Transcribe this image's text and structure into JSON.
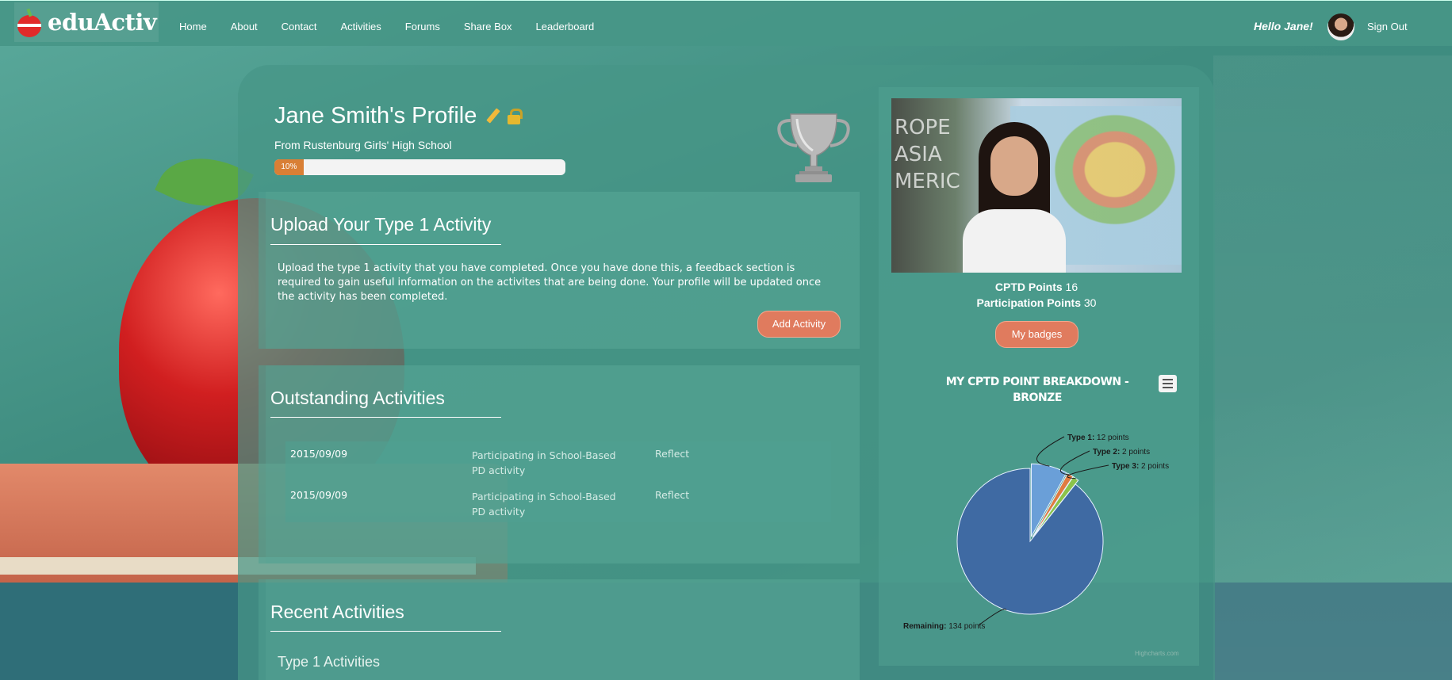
{
  "nav": {
    "brand": "eduActiv",
    "items": [
      "Home",
      "About",
      "Contact",
      "Activities",
      "Forums",
      "Share Box",
      "Leaderboard"
    ],
    "greeting": "Hello Jane!",
    "sign_out": "Sign Out"
  },
  "profile": {
    "title": "Jane Smith's Profile",
    "school": "From Rustenburg Girls' High School",
    "progress_label": "10%",
    "progress_value": 0.1
  },
  "upload": {
    "title": "Upload Your Type 1 Activity",
    "text": "Upload the type 1 activity that you have completed. Once you have done this, a feedback section is required to gain useful information on the activites that are being done. Your profile will be updated once the activity has been completed.",
    "button": "Add Activity"
  },
  "outstanding": {
    "title": "Outstanding Activities",
    "rows": [
      {
        "date": "2015/09/09",
        "activity": "Participating in School-Based PD activity",
        "action": "Reflect"
      },
      {
        "date": "2015/09/09",
        "activity": "Participating in School-Based PD activity",
        "action": "Reflect"
      }
    ]
  },
  "recent": {
    "title": "Recent Activities",
    "subheading": "Type 1 Activities"
  },
  "stats": {
    "cptd_label": "CPTD Points",
    "cptd_value": "16",
    "participation_label": "Participation Points",
    "participation_value": "30",
    "badges_button": "My badges"
  },
  "chart_data": {
    "type": "pie",
    "title": "MY CPTD POINT BREAKDOWN - BRONZE",
    "credit": "Highcharts.com",
    "slices": [
      {
        "name": "Type 1",
        "label": "12 points",
        "value": 12,
        "color": "#6a9fd8"
      },
      {
        "name": "Type 2",
        "label": "2 points",
        "value": 2,
        "color": "#e07b40"
      },
      {
        "name": "Type 3",
        "label": "2 points",
        "value": 2,
        "color": "#8bc34a"
      },
      {
        "name": "Remaining",
        "label": "134 points",
        "value": 134,
        "color": "#3f6aa3"
      }
    ]
  },
  "colors": {
    "accent_orange": "#e07b5e",
    "teal": "#3f8f82"
  }
}
